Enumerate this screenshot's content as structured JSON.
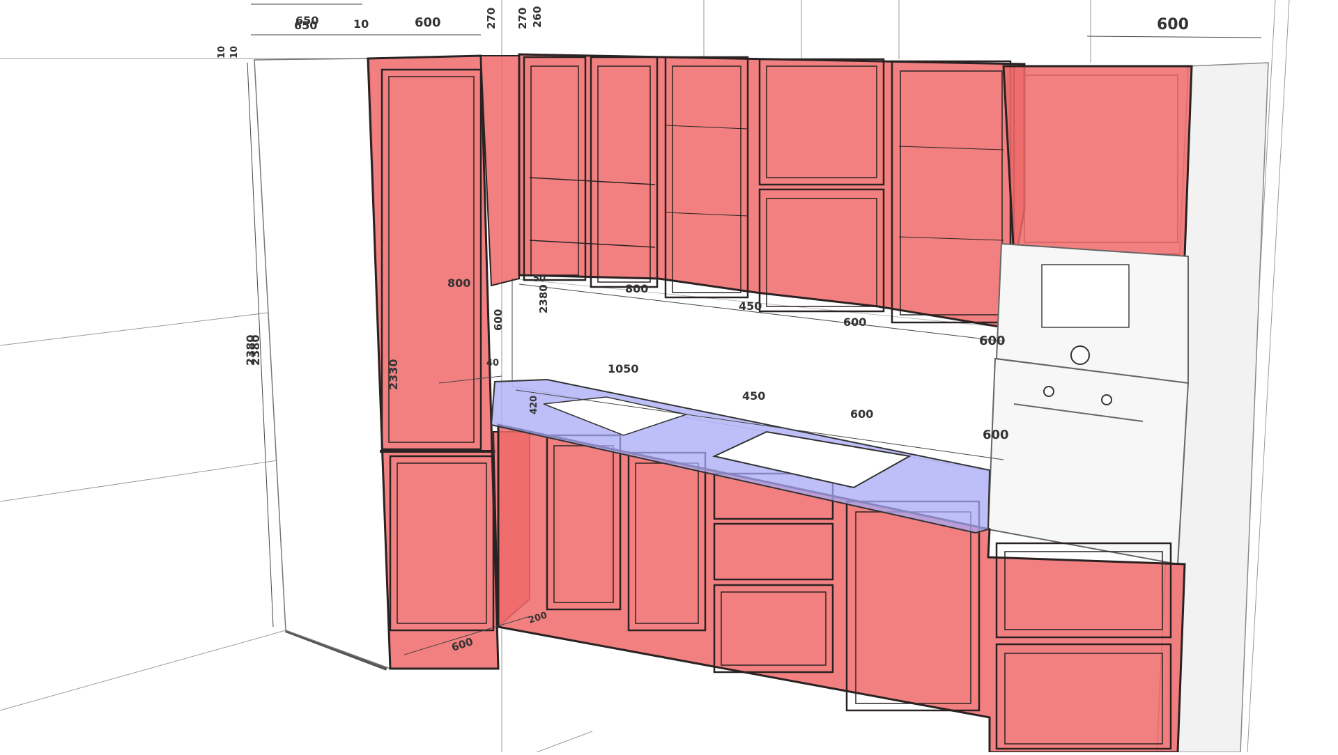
{
  "colors": {
    "cabinet_fill": "#f06a6a",
    "cabinet_stroke": "#2a2222",
    "countertop_fill": "#a8a8f6",
    "wall_stroke": "#9a9a9a",
    "appliance_fill": "#f2f2f2",
    "dimension_text": "#333333"
  },
  "dimensions": {
    "left_depth_outer": "650",
    "left_depth_inner": "650",
    "gap_10": "10",
    "top_600": "600",
    "h_270_a": "270",
    "h_270_b": "270",
    "h_260": "260",
    "right_top_600": "600",
    "left_10_a": "10",
    "left_10_b": "10",
    "total_height_a": "2380",
    "total_height_b": "2380",
    "tall_width_800": "800",
    "tall_height_2330": "2330",
    "wall_800": "800",
    "wall_450": "450",
    "wall_600_a": "600",
    "wall_600_b": "600",
    "splash_600": "600",
    "height_2380_mid": "2380",
    "gap_50": "50",
    "gap_40": "40",
    "counter_1050": "1050",
    "counter_450": "450",
    "counter_600_a": "600",
    "counter_600_b": "600",
    "depth_420": "420",
    "floor_600": "600",
    "floor_200": "200"
  }
}
